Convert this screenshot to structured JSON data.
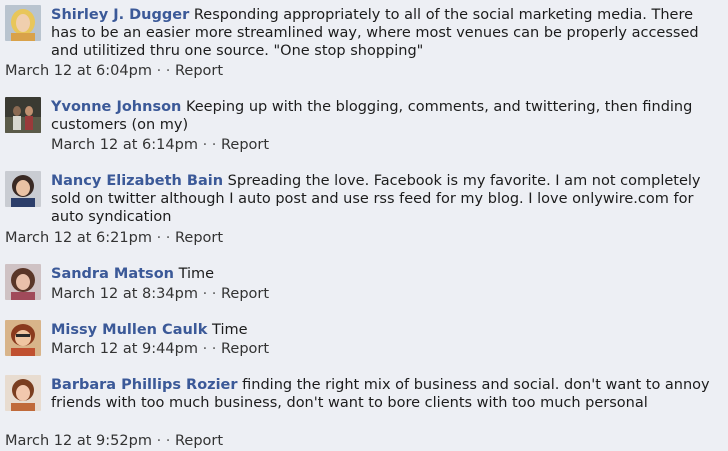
{
  "comments": [
    {
      "name": "Shirley J. Dugger",
      "text": "Responding appropriately to all of the social marketing media. There has to be an easier more streamlined way, where most venues can be properly accessed and utilitized thru one source. \"One stop shopping\"",
      "timestamp": "March 12 at 6:04pm",
      "separator": "·",
      "action_separator": "·",
      "action": "Report"
    },
    {
      "name": "Yvonne Johnson",
      "text": "Keeping up with the blogging, comments, and twittering, then finding customers (on my)",
      "timestamp": "March 12 at 6:14pm",
      "separator": "·",
      "action_separator": "·",
      "action": "Report"
    },
    {
      "name": "Nancy Elizabeth Bain",
      "text": "Spreading the love. Facebook is my favorite. I am not completely sold on twitter although I auto post and use rss feed for my blog. I love onlywire.com for auto syndication",
      "timestamp": "March 12 at 6:21pm",
      "separator": "·",
      "action_separator": "·",
      "action": "Report"
    },
    {
      "name": "Sandra Matson",
      "text": "Time",
      "timestamp": "March 12 at 8:34pm",
      "separator": "·",
      "action_separator": "·",
      "action": "Report"
    },
    {
      "name": "Missy Mullen Caulk",
      "text": "Time",
      "timestamp": "March 12 at 9:44pm",
      "separator": "·",
      "action_separator": "·",
      "action": "Report"
    },
    {
      "name": "Barbara Phillips Rozier",
      "text": "finding the right mix of business and social. don't want to annoy friends with too much business, don't want to bore clients with too much personal",
      "timestamp": "March 12 at 9:52pm",
      "separator": "·",
      "action_separator": "·",
      "action": "Report"
    }
  ],
  "colors": {
    "background": "#edeff4",
    "name_link": "#3b5998",
    "text": "#1c1c1c"
  }
}
